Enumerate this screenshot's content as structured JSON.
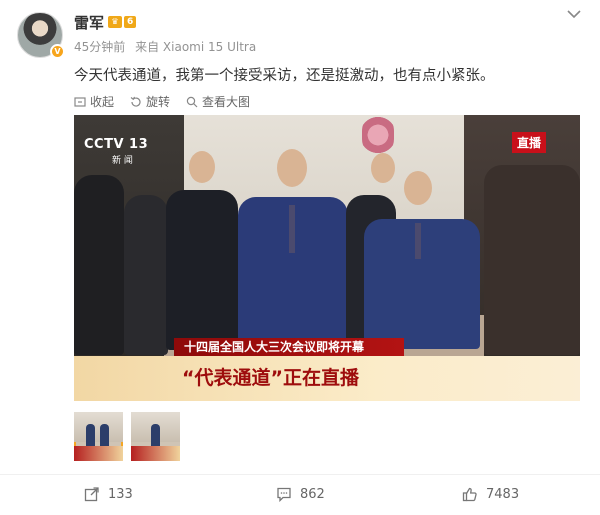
{
  "post": {
    "author": "雷军",
    "vip_level": "6",
    "time": "45分钟前",
    "source": "来自 Xiaomi 15 Ultra",
    "text": "今天代表通道，我第一个接受采访，还是挺激动，也有点小紧张。"
  },
  "actions_top": {
    "favorite": "收起",
    "rotate": "旋转",
    "view_large": "查看大图"
  },
  "media": {
    "channel": "CCTV 13",
    "channel_sub": "新 闻",
    "live_tag": "直播",
    "banner_top": "十四届全国人大三次会议即将开幕",
    "banner_main": "“代表通道”正在直播"
  },
  "footer": {
    "repost_count": "133",
    "comment_count": "862",
    "like_count": "7483"
  },
  "colors": {
    "accent_orange": "#f5a623",
    "live_red": "#c8101a",
    "text_primary": "#333333",
    "text_meta": "#939393"
  },
  "icons": {
    "more": "chevron-down-icon",
    "favorite": "collapse-icon",
    "rotate": "rotate-icon",
    "view_large": "zoom-icon",
    "repost": "share-icon",
    "comment": "comment-icon",
    "like": "thumbs-up-icon"
  }
}
